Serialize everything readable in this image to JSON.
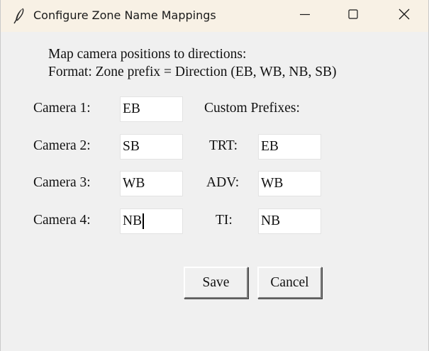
{
  "window": {
    "title": "Configure Zone Name Mappings",
    "icon": "feather-icon"
  },
  "titlebar_controls": [
    "minimize-icon",
    "maximize-icon",
    "close-icon"
  ],
  "instructions": {
    "line1": "Map camera positions to directions:",
    "line2": "Format: Zone prefix = Direction (EB, WB, NB, SB)"
  },
  "cameras": [
    {
      "label": "Camera 1:",
      "value": "EB"
    },
    {
      "label": "Camera 2:",
      "value": "SB"
    },
    {
      "label": "Camera 3:",
      "value": "WB"
    },
    {
      "label": "Camera 4:",
      "value": "NB"
    }
  ],
  "custom_prefixes": {
    "heading": "Custom Prefixes:",
    "items": [
      {
        "label": "TRT:",
        "value": "EB"
      },
      {
        "label": "ADV:",
        "value": "WB"
      },
      {
        "label": "TI:",
        "value": "NB"
      }
    ]
  },
  "buttons": {
    "save": "Save",
    "cancel": "Cancel"
  }
}
